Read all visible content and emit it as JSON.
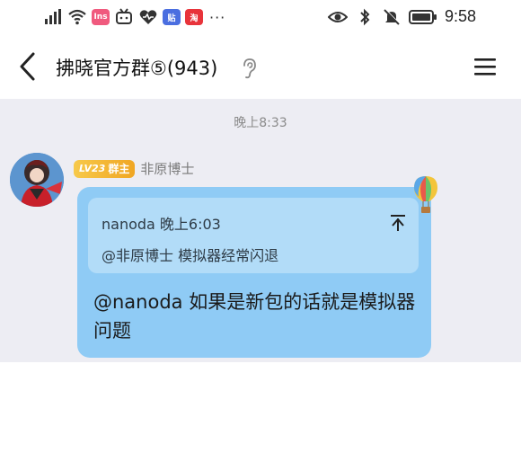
{
  "status_bar": {
    "app_badges": [
      {
        "label": "Ins",
        "color": "#f05a7e"
      },
      {
        "label": "ㄒ",
        "color": "#ffffff"
      },
      {
        "label": "♥",
        "color": "#ffffff"
      },
      {
        "label": "贴",
        "color": "#4a6ee0"
      },
      {
        "label": "淘",
        "color": "#e8343b"
      }
    ],
    "more": "···",
    "time": "9:58"
  },
  "header": {
    "title": "拂晓官方群⑤(943)"
  },
  "chat": {
    "timestamp": "晚上8:33",
    "message": {
      "level_badge": "LV23",
      "role_badge": "群主",
      "sender": "非原博士",
      "quote": {
        "meta": "nanoda 晚上6:03",
        "text": "@非原博士 模拟器经常闪退"
      },
      "text": "@nanoda 如果是新包的话就是模拟器问题"
    }
  },
  "colors": {
    "bubble": "#8fcbf5",
    "quote_bg": "#b2dcf8",
    "chat_bg": "#ededf3",
    "badge": "#f0a623"
  }
}
